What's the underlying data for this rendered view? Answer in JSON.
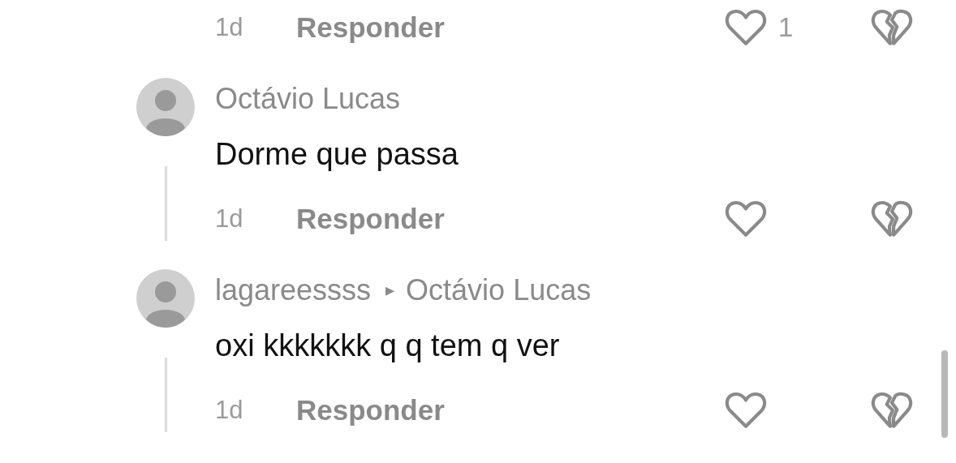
{
  "previous_comment_footer": {
    "time": "1d",
    "reply_label": "Responder",
    "likes": "1"
  },
  "comments": [
    {
      "author": "Octávio Lucas",
      "text": "Dorme que passa",
      "time": "1d",
      "reply_label": "Responder"
    },
    {
      "author": "lagareessss",
      "reply_marker": "▸",
      "reply_to": "Octávio Lucas",
      "text": "oxi kkkkkkk q q tem q ver",
      "time": "1d",
      "reply_label": "Responder"
    }
  ]
}
